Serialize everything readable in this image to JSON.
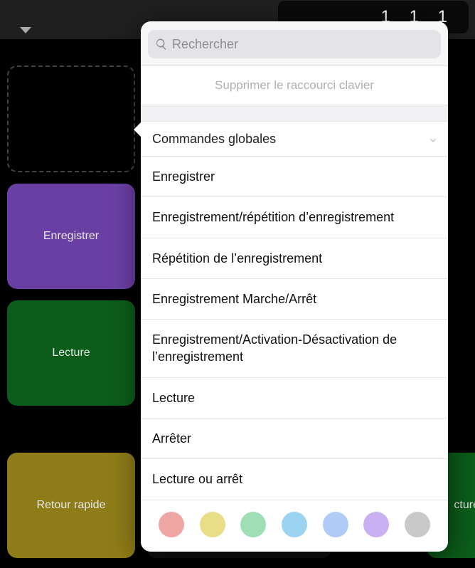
{
  "topbar": {
    "display_text": "1 1 1"
  },
  "bg_buttons": {
    "enregistrer": "Enregistrer",
    "lecture": "Lecture",
    "retour_rapide": "Retour rapide",
    "cture_frag": "cture"
  },
  "popover": {
    "search_placeholder": "Rechercher",
    "delete_label": "Supprimer le raccourci clavier",
    "section_header": "Commandes globales",
    "items": [
      "Enregistrer",
      "Enregistrement/répétition d’enregistrement",
      "Répétition de l’enregistrement",
      "Enregistrement Marche/Arrêt",
      "Enregistrement/Activation-Désactivation de l’enregistrement",
      "Lecture",
      "Arrêter",
      "Lecture ou arrêt"
    ],
    "colors": [
      "#eea7a3",
      "#eadd88",
      "#a0dfb6",
      "#9cd3f0",
      "#b0cbf7",
      "#c9b0f2",
      "#c9c9c9"
    ]
  }
}
